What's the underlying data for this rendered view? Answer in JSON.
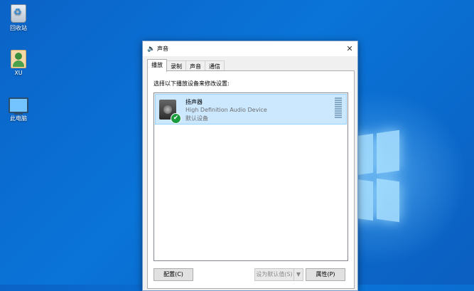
{
  "desktop": {
    "icons": [
      {
        "label": "回收站",
        "icon": "recycle-bin-icon"
      },
      {
        "label": "XU",
        "icon": "user-folder-icon"
      },
      {
        "label": "此电脑",
        "icon": "this-pc-icon"
      }
    ]
  },
  "dialog": {
    "title": "声音",
    "title_icon": "speaker-icon",
    "close_glyph": "✕",
    "tabs": [
      {
        "label": "播放",
        "active": true
      },
      {
        "label": "录制",
        "active": false
      },
      {
        "label": "声音",
        "active": false
      },
      {
        "label": "通信",
        "active": false
      }
    ],
    "instruction": "选择以下播放设备来修改设置:",
    "devices": [
      {
        "name": "扬声器",
        "description": "High Definition Audio Device",
        "status": "默认设备",
        "icon": "speaker-device-icon",
        "badge_glyph": "✔"
      }
    ],
    "buttons": {
      "configure": "配置(C)",
      "set_default": "设为默认值(S)",
      "set_default_arrow": "▼",
      "properties": "属性(P)"
    }
  },
  "colors": {
    "desktop_bg": "#0a74d8",
    "selected_item": "#cce8ff",
    "default_check": "#1a9c3e"
  }
}
